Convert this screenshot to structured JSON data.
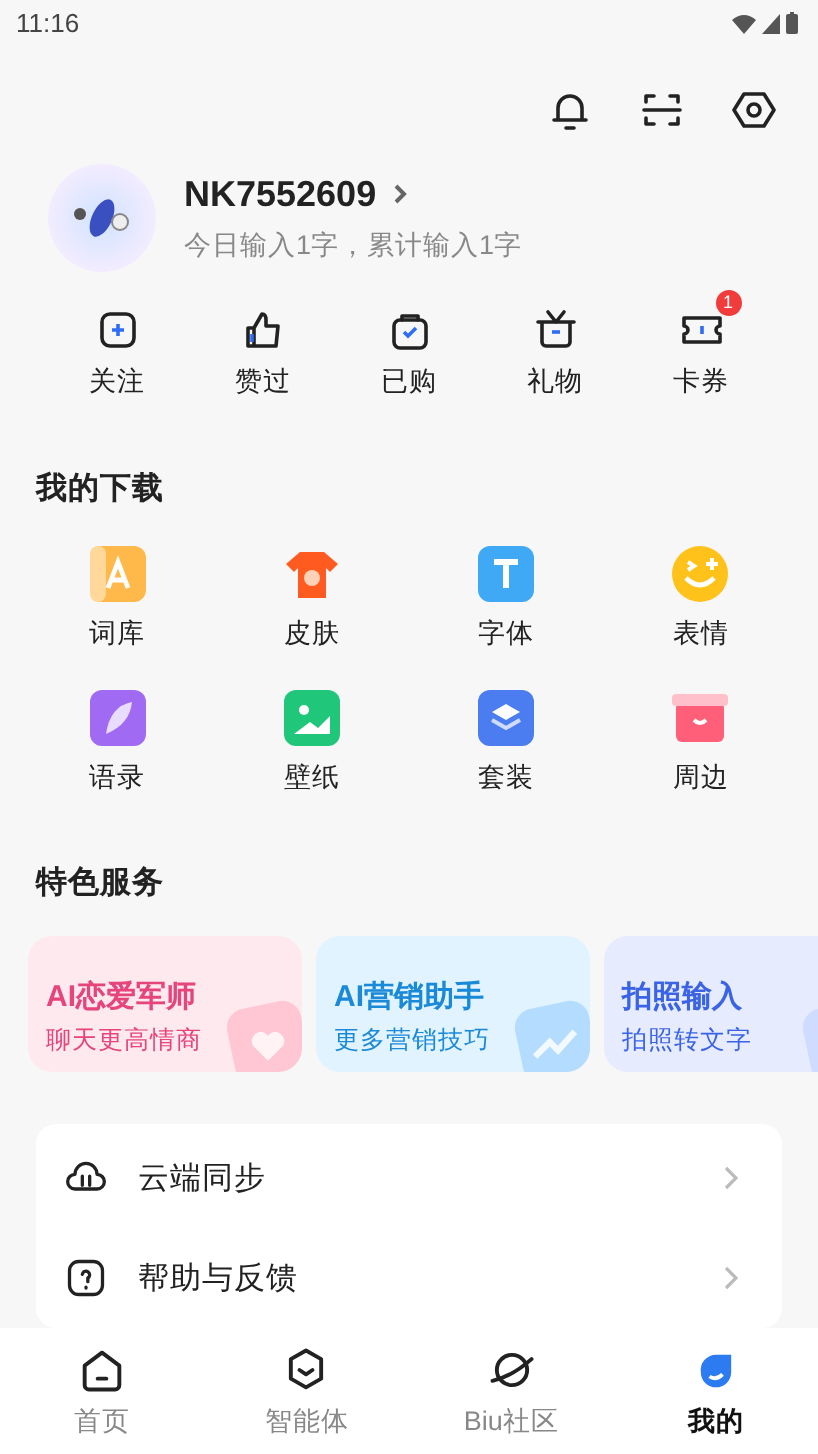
{
  "status_bar": {
    "time": "11:16"
  },
  "profile": {
    "name": "NK7552609",
    "stats": "今日输入1字，累计输入1字"
  },
  "quick_actions": [
    {
      "label": "关注"
    },
    {
      "label": "赞过"
    },
    {
      "label": "已购"
    },
    {
      "label": "礼物"
    },
    {
      "label": "卡券",
      "badge": "1"
    }
  ],
  "downloads": {
    "title": "我的下载",
    "items": [
      {
        "label": "词库"
      },
      {
        "label": "皮肤"
      },
      {
        "label": "字体"
      },
      {
        "label": "表情"
      },
      {
        "label": "语录"
      },
      {
        "label": "壁纸"
      },
      {
        "label": "套装"
      },
      {
        "label": "周边"
      }
    ]
  },
  "services": {
    "title": "特色服务",
    "cards": [
      {
        "title": "AI恋爱军师",
        "subtitle": "聊天更高情商",
        "color": "#e6447c"
      },
      {
        "title": "AI营销助手",
        "subtitle": "更多营销技巧",
        "color": "#1a8ad8"
      },
      {
        "title": "拍照输入",
        "subtitle": "拍照转文字",
        "color": "#3b63e6"
      }
    ]
  },
  "menu": [
    {
      "label": "云端同步"
    },
    {
      "label": "帮助与反馈"
    }
  ],
  "tabs": [
    {
      "label": "首页",
      "selected": false
    },
    {
      "label": "智能体",
      "selected": false
    },
    {
      "label": "Biu社区",
      "selected": false
    },
    {
      "label": "我的",
      "selected": true
    }
  ]
}
